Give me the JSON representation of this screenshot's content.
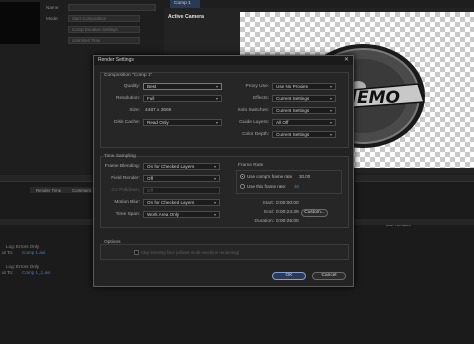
{
  "background": {
    "project_fields": [
      {
        "label": "Name:",
        "value": ""
      },
      {
        "label": "Mode:",
        "value": "Start Composition"
      },
      {
        "label": "",
        "value": "Comp Duration Settings"
      },
      {
        "label": "",
        "value": "Unlimited Time"
      }
    ],
    "viewer_tab": "Comp 1",
    "active_camera_label": "Active Camera",
    "logo_text": "MEMO",
    "timeline_headers": {
      "render_time": "Render Time",
      "comment": "Comment",
      "remain": "Est. Remain:"
    },
    "log_rows": [
      {
        "label": "Log:",
        "value": "Errors Only",
        "output_label": "ut To:",
        "output": "Comp 1.avi"
      },
      {
        "label": "Log:",
        "value": "Errors Only",
        "output_label": "ut To:",
        "output": "Comp 1_1.avi"
      }
    ]
  },
  "dialog": {
    "title": "Render Settings",
    "close_icon": "close-icon",
    "composition": {
      "group_title": "Composition \"Comp 1\"",
      "left_fields": [
        {
          "label": "Quality:",
          "value": "Best",
          "type": "select",
          "focused": true
        },
        {
          "label": "Resolution:",
          "value": "Full",
          "type": "select"
        },
        {
          "label": "Size:",
          "value": "4487 x 3666",
          "type": "text"
        },
        {
          "label": "Disk Cache:",
          "value": "Read Only",
          "type": "select"
        }
      ],
      "right_fields": [
        {
          "label": "Proxy Use:",
          "value": "Use No Proxies"
        },
        {
          "label": "Effects:",
          "value": "Current Settings"
        },
        {
          "label": "Solo Switches:",
          "value": "Current Settings"
        },
        {
          "label": "Guide Layers:",
          "value": "All Off"
        },
        {
          "label": "Color Depth:",
          "value": "Current Settings"
        }
      ]
    },
    "time_sampling": {
      "section_title": "Time Sampling",
      "frame_blending_label": "Frame Blending:",
      "frame_blending_value": "On for Checked Layers",
      "field_render_label": "Field Render:",
      "field_render_value": "Off",
      "pulldown_label": "3:2 Pulldown:",
      "pulldown_value": "Off",
      "motion_blur_label": "Motion Blur:",
      "motion_blur_value": "On for Checked Layers",
      "time_span_label": "Time Span:",
      "time_span_value": "Work Area Only",
      "frame_rate_title": "Frame Rate",
      "use_comp_rate_label": "Use comp's frame rate",
      "use_comp_rate_value": "30.00",
      "use_this_rate_label": "Use this frame rate:",
      "use_this_rate_value": "30",
      "start_label": "Start:",
      "start_value": "0:00:00:00",
      "end_label": "End:",
      "end_value": "0:00:24:29",
      "duration_label": "Duration:",
      "duration_value": "0:00:25:00",
      "custom_button": "Custom..."
    },
    "options": {
      "section_title": "Options",
      "skip_existing_label": "Skip existing files (allows multi-machine rendering)"
    },
    "ok_button": "OK",
    "cancel_button": "Cancel"
  }
}
